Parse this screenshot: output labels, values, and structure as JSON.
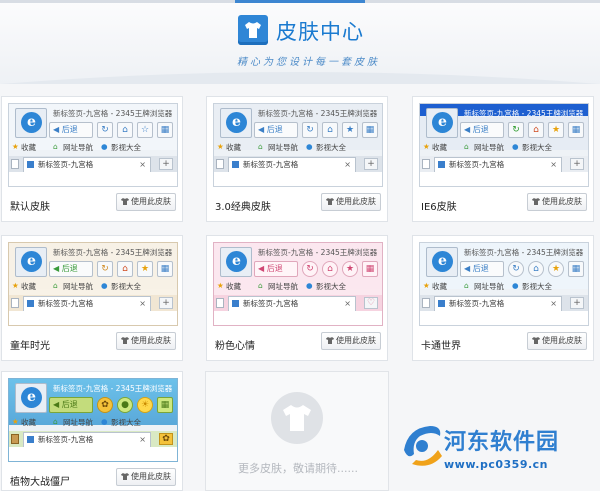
{
  "header": {
    "title": "皮肤中心",
    "subtitle": "精心为您设计每一套皮肤"
  },
  "preview_common": {
    "window_title": "新标签页-九宫格 - 2345王牌浏览器",
    "back_label": "后退",
    "favorites_label": "收藏",
    "nav_site_label": "网址导航",
    "video_label": "影视大全",
    "tab_label": "新标签页-九宫格",
    "tab_close": "×",
    "new_tab": "+"
  },
  "use_button_label": "使用此皮肤",
  "skins": [
    {
      "name": "默认皮肤"
    },
    {
      "name": "3.0经典皮肤"
    },
    {
      "name": "IE6皮肤"
    },
    {
      "name": "童年时光"
    },
    {
      "name": "粉色心情"
    },
    {
      "name": "卡通世界"
    },
    {
      "name": "植物大战僵尸"
    }
  ],
  "more": {
    "text": "更多皮肤，敬请期待......"
  },
  "watermark": {
    "title": "河东软件园",
    "url": "www.pc0359.cn"
  },
  "colors": {
    "accent": "#1a7ad0",
    "ie6_titlebar": "#1d5fd0",
    "pink": "#fbe7ef"
  }
}
